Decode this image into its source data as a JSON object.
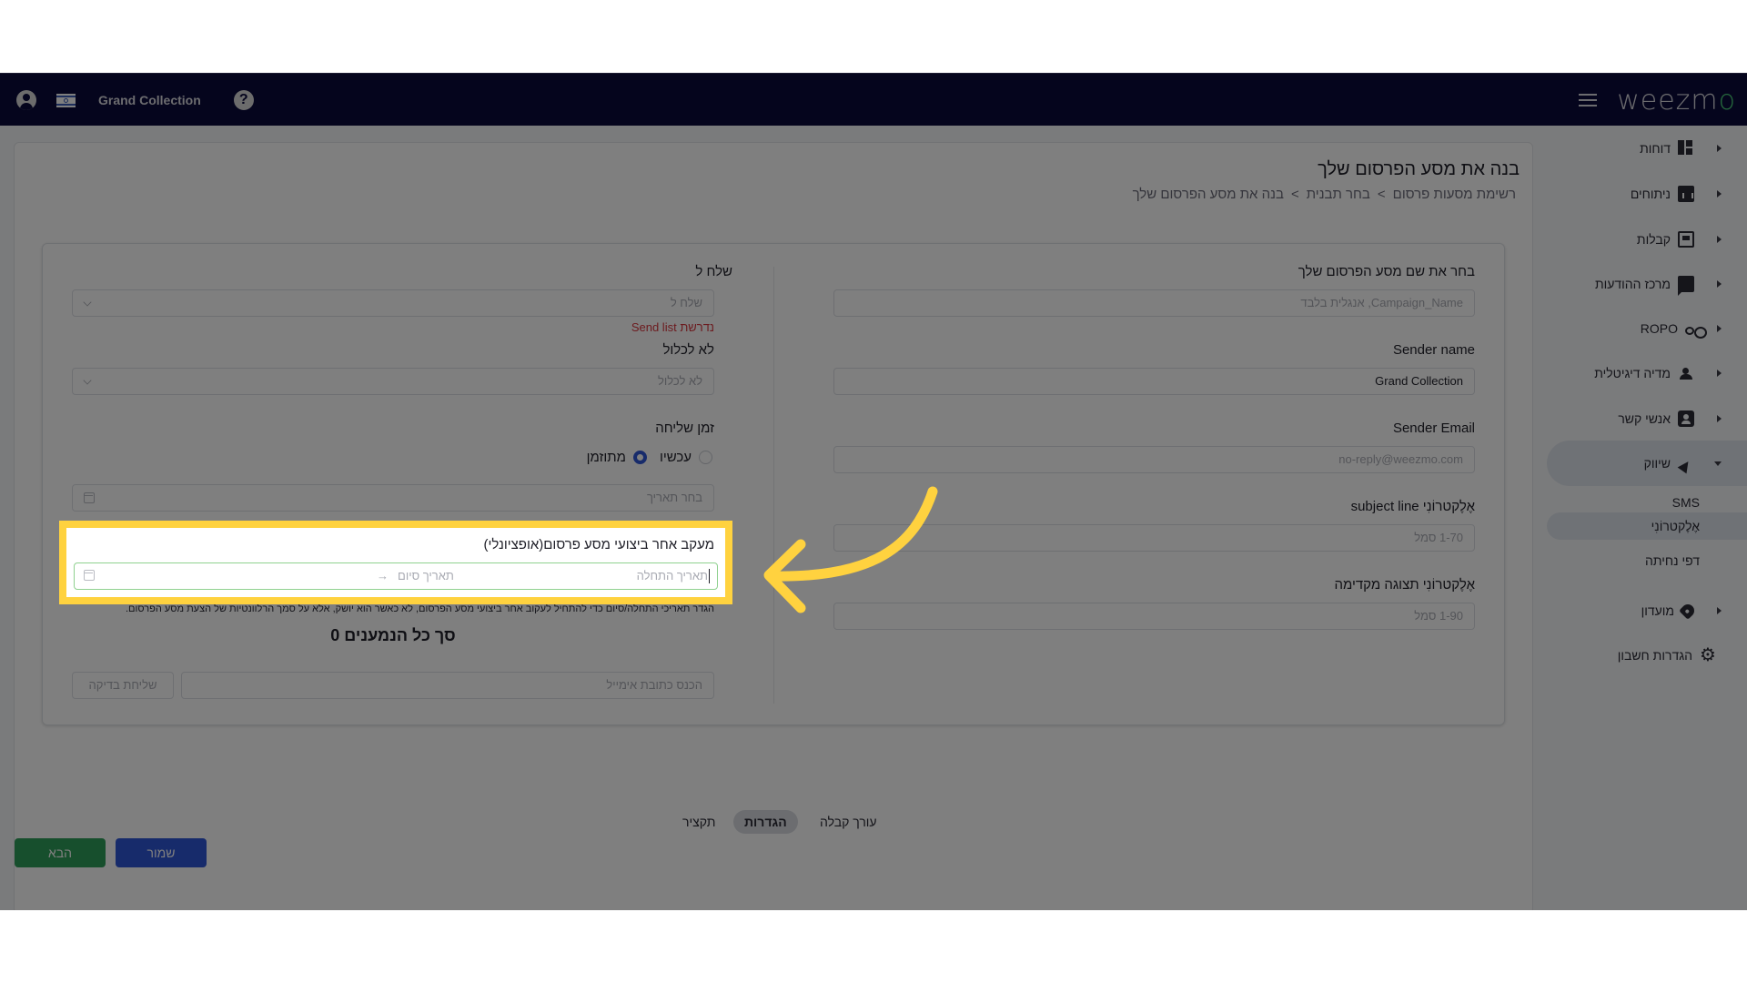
{
  "topbar": {
    "account_name": "Grand Collection",
    "logo_text": "weezm",
    "logo_accent": "o",
    "icons": [
      "user-icon",
      "israel-flag-icon",
      "help-icon",
      "hamburger-menu-icon"
    ],
    "help_glyph": "?"
  },
  "sidebar": {
    "items": [
      {
        "label": "דוחות",
        "icon": "dashboard-icon"
      },
      {
        "label": "ניתוחים",
        "icon": "analytics-icon"
      },
      {
        "label": "קבלות",
        "icon": "receipt-icon"
      },
      {
        "label": "מרכז ההודעות",
        "icon": "chat-icon"
      },
      {
        "label": "ROPO",
        "icon": "infinity-icon"
      },
      {
        "label": "מדיה דיגיטלית",
        "icon": "people-icon"
      },
      {
        "label": "אנשי קשר",
        "icon": "contact-icon"
      },
      {
        "label": "שיווק",
        "icon": "party-icon",
        "expanded": true
      },
      {
        "label": "מועדון",
        "icon": "tag-icon"
      },
      {
        "label": "הגדרות חשבון",
        "icon": "gear-icon"
      }
    ],
    "sub_items": [
      {
        "label": "SMS"
      },
      {
        "label": "אֶלֶקטרוֹנִי",
        "active": true
      },
      {
        "label": "דפי נחיתה"
      }
    ]
  },
  "page": {
    "title": "בנה את מסע הפרסום שלך",
    "breadcrumb": [
      "רשימת מסעות פרסום",
      "בחר תבנית",
      "בנה את מסע הפרסום שלך"
    ],
    "breadcrumb_sep": ">"
  },
  "form_right": {
    "campaign_name_label": "בחר את שם מסע הפרסום שלך",
    "campaign_name_placeholder": "Campaign_Name, אנגלית בלבד",
    "sender_name_label": "Sender name",
    "sender_name_value": "Grand Collection",
    "sender_email_label": "Sender Email",
    "sender_email_placeholder": "no-reply@weezmo.com",
    "subject_label": "אֶלֶקטרוֹנִי subject line",
    "subject_placeholder": "1-70 סמל",
    "preview_label": "אֶלֶקטרוֹנִי תצוגה מקדימה",
    "preview_placeholder": "1-90 סמל"
  },
  "form_left": {
    "send_to_label": "שלח ל",
    "send_to_placeholder": "שלח ל",
    "send_to_error": "נדרשת Send list",
    "exclude_label": "לא לכלול",
    "exclude_placeholder": "לא לכלול",
    "send_time_label": "זמן שליחה",
    "send_time_options": [
      {
        "label": "עכשיו",
        "checked": false
      },
      {
        "label": "מתוזמן",
        "checked": true
      }
    ],
    "date_placeholder": "בחר תאריך",
    "tracking_label": "מעקב אחר ביצועי מסע פרסום(אופציונלי)",
    "tracking_start_placeholder": "תאריך התחלה",
    "tracking_end_placeholder": "תאריך סיום",
    "tracking_arrow": "→",
    "tracking_help": "הגדר תאריכי התחלה/סיום כדי להתחיל לעקוב אחר ביצועי מסע הפרסום, לא כאשר הוא יושק, אלא על סמך הרלוונטיות של הצעת מסע הפרסום.",
    "total_recipients": "סך כל הנמענים 0",
    "test_email_placeholder": "הכנס כתובת אימייל",
    "test_send_label": "שליחת בדיקה"
  },
  "tabs": [
    {
      "label": "עורך קבלה",
      "active": false
    },
    {
      "label": "הגדרות",
      "active": true
    },
    {
      "label": "תקציר",
      "active": false
    }
  ],
  "actions": {
    "save_label": "שמור",
    "next_label": "הבא"
  },
  "colors": {
    "topbar_bg": "#0b0a3a",
    "logo_accent": "#4bd07a",
    "highlight": "#ffd23f",
    "save_btn": "#2f56d6",
    "next_btn": "#2f9e5a",
    "error": "#d9363e"
  }
}
